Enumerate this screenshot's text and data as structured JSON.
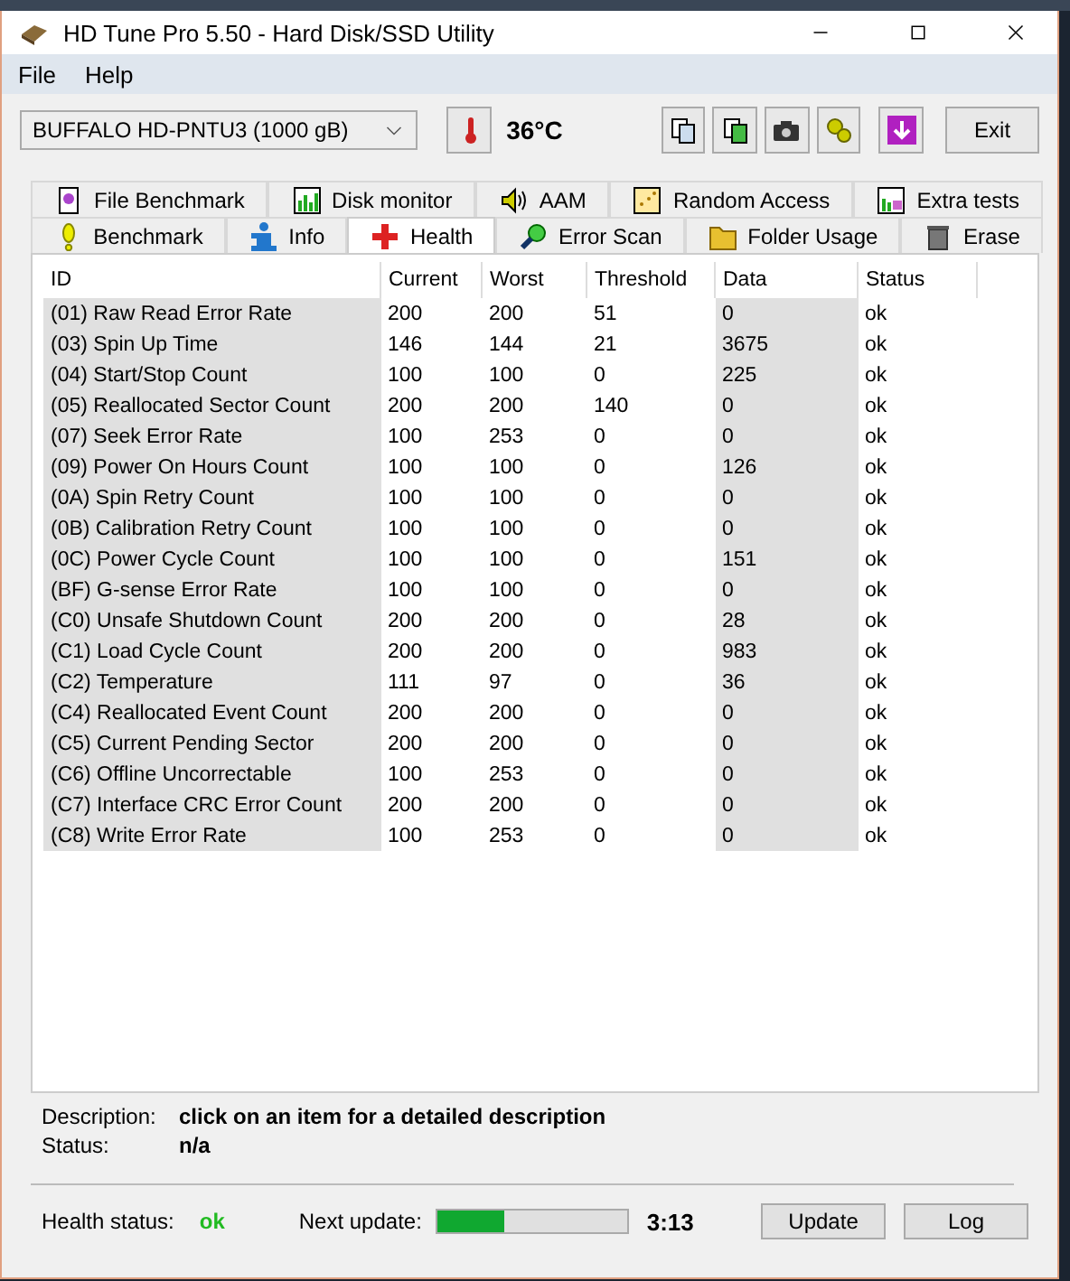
{
  "window": {
    "title": "HD Tune Pro 5.50 - Hard Disk/SSD Utility"
  },
  "menu": [
    "File",
    "Help"
  ],
  "toolbar": {
    "drive": "BUFFALO HD-PNTU3 (1000 gB)",
    "temperature": "36°C",
    "exit": "Exit"
  },
  "tab_rows": [
    [
      {
        "label": "File Benchmark",
        "selected": false
      },
      {
        "label": "Disk monitor",
        "selected": false
      },
      {
        "label": "AAM",
        "selected": false
      },
      {
        "label": "Random Access",
        "selected": false
      },
      {
        "label": "Extra tests",
        "selected": false
      }
    ],
    [
      {
        "label": "Benchmark",
        "selected": false
      },
      {
        "label": "Info",
        "selected": false
      },
      {
        "label": "Health",
        "selected": true
      },
      {
        "label": "Error Scan",
        "selected": false
      },
      {
        "label": "Folder Usage",
        "selected": false
      },
      {
        "label": "Erase",
        "selected": false
      }
    ]
  ],
  "table": {
    "columns": [
      "ID",
      "Current",
      "Worst",
      "Threshold",
      "Data",
      "Status"
    ],
    "rows": [
      [
        "(01) Raw Read Error Rate",
        "200",
        "200",
        "51",
        "0",
        "ok"
      ],
      [
        "(03) Spin Up Time",
        "146",
        "144",
        "21",
        "3675",
        "ok"
      ],
      [
        "(04) Start/Stop Count",
        "100",
        "100",
        "0",
        "225",
        "ok"
      ],
      [
        "(05) Reallocated Sector Count",
        "200",
        "200",
        "140",
        "0",
        "ok"
      ],
      [
        "(07) Seek Error Rate",
        "100",
        "253",
        "0",
        "0",
        "ok"
      ],
      [
        "(09) Power On Hours Count",
        "100",
        "100",
        "0",
        "126",
        "ok"
      ],
      [
        "(0A) Spin Retry Count",
        "100",
        "100",
        "0",
        "0",
        "ok"
      ],
      [
        "(0B) Calibration Retry Count",
        "100",
        "100",
        "0",
        "0",
        "ok"
      ],
      [
        "(0C) Power Cycle Count",
        "100",
        "100",
        "0",
        "151",
        "ok"
      ],
      [
        "(BF) G-sense Error Rate",
        "100",
        "100",
        "0",
        "0",
        "ok"
      ],
      [
        "(C0) Unsafe Shutdown Count",
        "200",
        "200",
        "0",
        "28",
        "ok"
      ],
      [
        "(C1) Load Cycle Count",
        "200",
        "200",
        "0",
        "983",
        "ok"
      ],
      [
        "(C2) Temperature",
        "111",
        "97",
        "0",
        "36",
        "ok"
      ],
      [
        "(C4) Reallocated Event Count",
        "200",
        "200",
        "0",
        "0",
        "ok"
      ],
      [
        "(C5) Current Pending Sector",
        "200",
        "200",
        "0",
        "0",
        "ok"
      ],
      [
        "(C6) Offline Uncorrectable",
        "100",
        "253",
        "0",
        "0",
        "ok"
      ],
      [
        "(C7) Interface CRC Error Count",
        "200",
        "200",
        "0",
        "0",
        "ok"
      ],
      [
        "(C8) Write Error Rate",
        "100",
        "253",
        "0",
        "0",
        "ok"
      ]
    ]
  },
  "details": [
    {
      "label": "Description:",
      "value": "click on an item for a detailed description"
    },
    {
      "label": "Status:",
      "value": "n/a"
    }
  ],
  "footer": {
    "health_label": "Health status:",
    "health_value": "ok",
    "update_label": "Next update:",
    "level": 0.35,
    "countdown": "3:13",
    "buttons": [
      "Update",
      "Log"
    ]
  }
}
